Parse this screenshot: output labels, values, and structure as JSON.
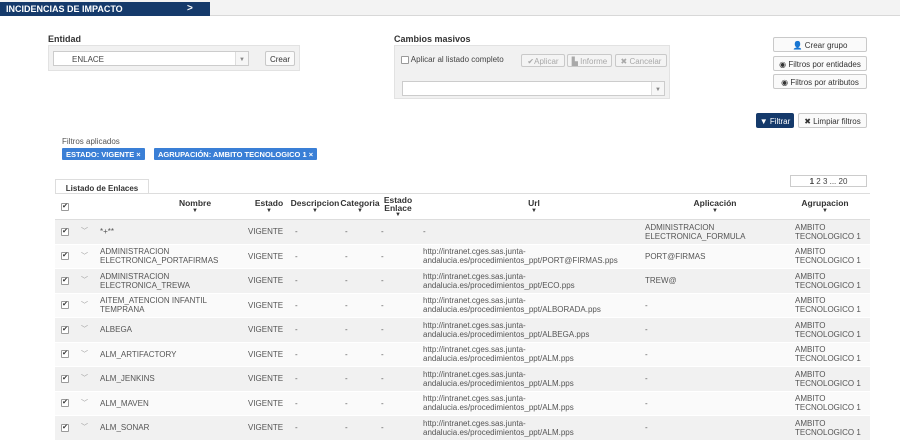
{
  "header": {
    "tab_label": "INCIDENCIAS DE IMPACTO",
    "chevron": ">"
  },
  "entidad": {
    "label": "Entidad",
    "selected": "ENLACE",
    "create_label": "Crear"
  },
  "cambios": {
    "label": "Cambios masivos",
    "apply_all_label": "Aplicar al listado completo",
    "aplicar": "✔Aplicar",
    "informe": "▙ Informe",
    "cancelar": "✖ Cancelar",
    "selected": ""
  },
  "right_buttons": {
    "crear_grupo": "Crear grupo",
    "filtros_entidades": "Filtros por entidades",
    "filtros_atributos": "Filtros por atributos",
    "filtrar": "Filtrar",
    "limpiar": "Limpiar filtros"
  },
  "filters": {
    "label": "Filtros aplicados",
    "chips": [
      "ESTADO: VIGENTE ×",
      "AGRUPACIÓN: AMBITO TECNOLOGICO 1 ×"
    ]
  },
  "list": {
    "tab_label": "Listado de Enlaces"
  },
  "pagination": {
    "current": "1",
    "pages": "2 3 ... 20"
  },
  "table": {
    "headers": {
      "nombre": "Nombre",
      "estado": "Estado",
      "descripcion": "Descripcion",
      "categoria": "Categoria",
      "estado_enlace_1": "Estado",
      "estado_enlace_2": "Enlace",
      "url": "Url",
      "aplicacion": "Aplicación",
      "agrupacion": "Agrupacion"
    },
    "rows": [
      {
        "nombre": "*+**",
        "estado": "VIGENTE",
        "descripcion": "-",
        "categoria": "-",
        "estado_enlace": "-",
        "url": "-",
        "aplicacion": "ADMINISTRACION ELECTRONICA_FORMULA",
        "agrupacion": "AMBITO TECNOLOGICO 1"
      },
      {
        "nombre": "ADMINISTRACION ELECTRONICA_PORTAFIRMAS",
        "estado": "VIGENTE",
        "descripcion": "-",
        "categoria": "-",
        "estado_enlace": "-",
        "url": "http://intranet.cges.sas.junta-andalucia.es/procedimientos_ppt/PORT@FIRMAS.pps",
        "aplicacion": "PORT@FIRMAS",
        "agrupacion": "AMBITO TECNOLOGICO 1"
      },
      {
        "nombre": "ADMINISTRACION ELECTRONICA_TREWA",
        "estado": "VIGENTE",
        "descripcion": "-",
        "categoria": "-",
        "estado_enlace": "-",
        "url": "http://intranet.cges.sas.junta-andalucia.es/procedimientos_ppt/ECO.pps",
        "aplicacion": "TREW@",
        "agrupacion": "AMBITO TECNOLOGICO 1"
      },
      {
        "nombre": "AITEM_ATENCION INFANTIL TEMPRANA",
        "estado": "VIGENTE",
        "descripcion": "-",
        "categoria": "-",
        "estado_enlace": "-",
        "url": "http://intranet.cges.sas.junta-andalucia.es/procedimientos_ppt/ALBORADA.pps",
        "aplicacion": "-",
        "agrupacion": "AMBITO TECNOLOGICO 1"
      },
      {
        "nombre": "ALBEGA",
        "estado": "VIGENTE",
        "descripcion": "-",
        "categoria": "-",
        "estado_enlace": "-",
        "url": "http://intranet.cges.sas.junta-andalucia.es/procedimientos_ppt/ALBEGA.pps",
        "aplicacion": "-",
        "agrupacion": "AMBITO TECNOLOGICO 1"
      },
      {
        "nombre": "ALM_ARTIFACTORY",
        "estado": "VIGENTE",
        "descripcion": "-",
        "categoria": "-",
        "estado_enlace": "-",
        "url": "http://intranet.cges.sas.junta-andalucia.es/procedimientos_ppt/ALM.pps",
        "aplicacion": "-",
        "agrupacion": "AMBITO TECNOLOGICO 1"
      },
      {
        "nombre": "ALM_JENKINS",
        "estado": "VIGENTE",
        "descripcion": "-",
        "categoria": "-",
        "estado_enlace": "-",
        "url": "http://intranet.cges.sas.junta-andalucia.es/procedimientos_ppt/ALM.pps",
        "aplicacion": "-",
        "agrupacion": "AMBITO TECNOLOGICO 1"
      },
      {
        "nombre": "ALM_MAVEN",
        "estado": "VIGENTE",
        "descripcion": "-",
        "categoria": "-",
        "estado_enlace": "-",
        "url": "http://intranet.cges.sas.junta-andalucia.es/procedimientos_ppt/ALM.pps",
        "aplicacion": "-",
        "agrupacion": "AMBITO TECNOLOGICO 1"
      },
      {
        "nombre": "ALM_SONAR",
        "estado": "VIGENTE",
        "descripcion": "-",
        "categoria": "-",
        "estado_enlace": "-",
        "url": "http://intranet.cges.sas.junta-andalucia.es/procedimientos_ppt/ALM.pps",
        "aplicacion": "-",
        "agrupacion": "AMBITO TECNOLOGICO 1"
      }
    ]
  },
  "icons": {
    "checkbox_checked": "check-icon",
    "row_expand": "chevron-down-icon",
    "user": "user-icon",
    "eye": "eye-icon",
    "filter": "filter-icon"
  },
  "colors": {
    "brand": "#153a6b",
    "chip": "#3a7fd6"
  }
}
